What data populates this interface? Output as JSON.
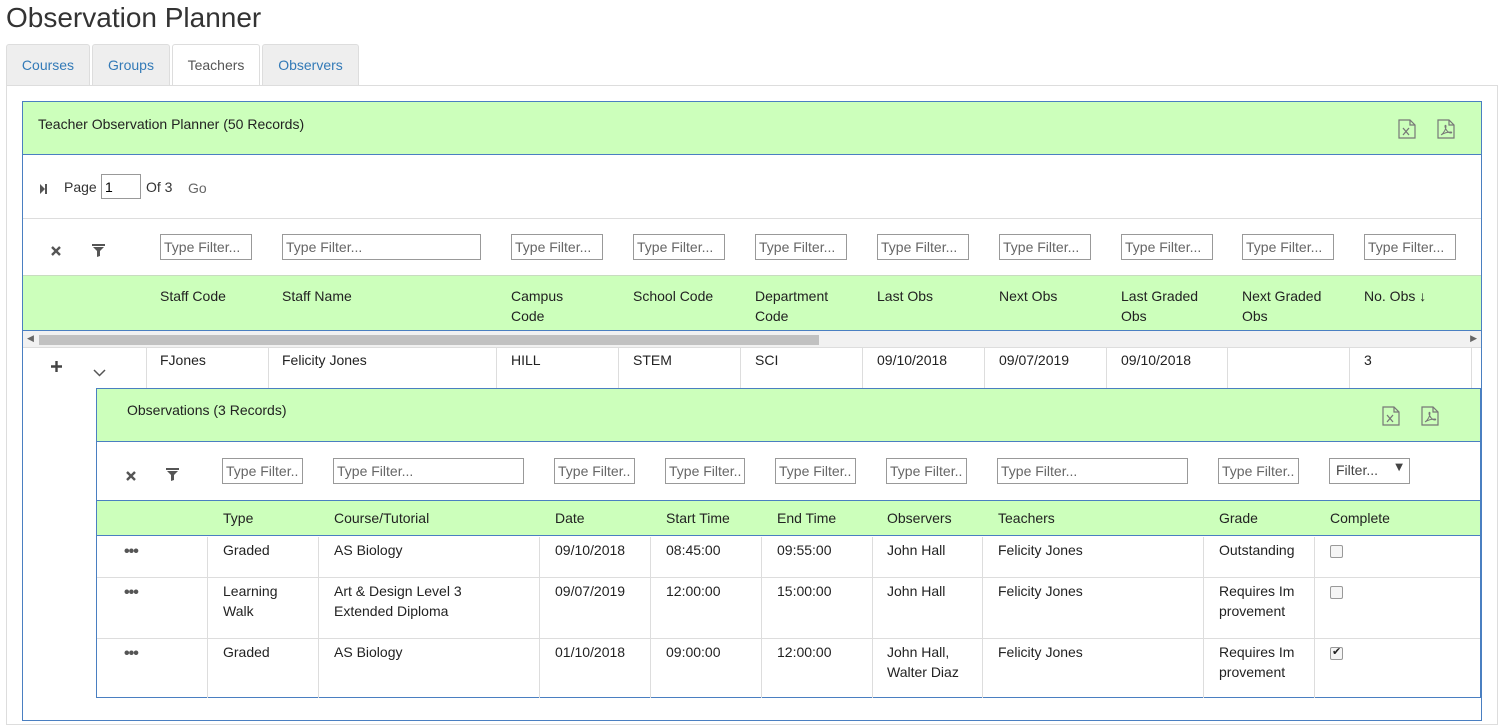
{
  "page": {
    "title": "Observation Planner"
  },
  "tabs": [
    {
      "label": "Courses",
      "active": false
    },
    {
      "label": "Groups",
      "active": false
    },
    {
      "label": "Teachers",
      "active": true
    },
    {
      "label": "Observers",
      "active": false
    }
  ],
  "grid": {
    "title": "Teacher Observation Planner (50 Records)",
    "pager": {
      "page_label": "Page",
      "page_value": "1",
      "of_label": "Of 3",
      "go_label": "Go"
    },
    "filter_placeholder": "Type Filter...",
    "columns": [
      "Staff Code",
      "Staff Name",
      "Campus Code",
      "School Code",
      "Department Code",
      "Last Obs",
      "Next Obs",
      "Last Graded Obs",
      "Next Graded Obs",
      "No. Obs ↓"
    ],
    "row": {
      "expand_symbol": "+",
      "cells": [
        "FJones",
        "Felicity Jones",
        "HILL",
        "STEM",
        "SCI",
        "09/10/2018",
        "09/07/2019",
        "09/10/2018",
        "",
        "3"
      ]
    }
  },
  "observations": {
    "title": "Observations (3 Records)",
    "filter_placeholder": "Type Filter...",
    "select_filter": "Filter...",
    "columns": [
      "Type",
      "Course/Tutorial",
      "Date",
      "Start Time",
      "End Time",
      "Observers",
      "Teachers",
      "Grade",
      "Complete"
    ],
    "rows": [
      {
        "type": "Graded",
        "course": "AS Biology",
        "date": "09/10/2018",
        "start": "08:45:00",
        "end": "09:55:00",
        "observers": "John Hall",
        "teachers": "Felicity Jones",
        "grade": "Outstanding",
        "complete": false
      },
      {
        "type": "Learning Walk",
        "course": "Art & Design Level 3 Extended Diploma",
        "date": "09/07/2019",
        "start": "12:00:00",
        "end": "15:00:00",
        "observers": "John Hall",
        "teachers": "Felicity Jones",
        "grade": "Requires Improvement",
        "complete": false
      },
      {
        "type": "Graded",
        "course": "AS Biology",
        "date": "01/10/2018",
        "start": "09:00:00",
        "end": "12:00:00",
        "observers": "John Hall, Walter Diaz",
        "teachers": "Felicity Jones",
        "grade": "Requires Improvement",
        "complete": true
      }
    ],
    "row_menu_symbol": "•••"
  },
  "icons": {
    "excel": "excel-export-icon",
    "pdf": "pdf-export-icon",
    "clear": "clear-filter-icon",
    "filter": "filter-icon",
    "first_page": "first-page-icon",
    "expand": "plus-icon",
    "collapse": "chevron-down-icon"
  },
  "colors": {
    "header_green": "#ccffbb",
    "border_blue": "#4a7fc1",
    "link_blue": "#337ab7"
  }
}
